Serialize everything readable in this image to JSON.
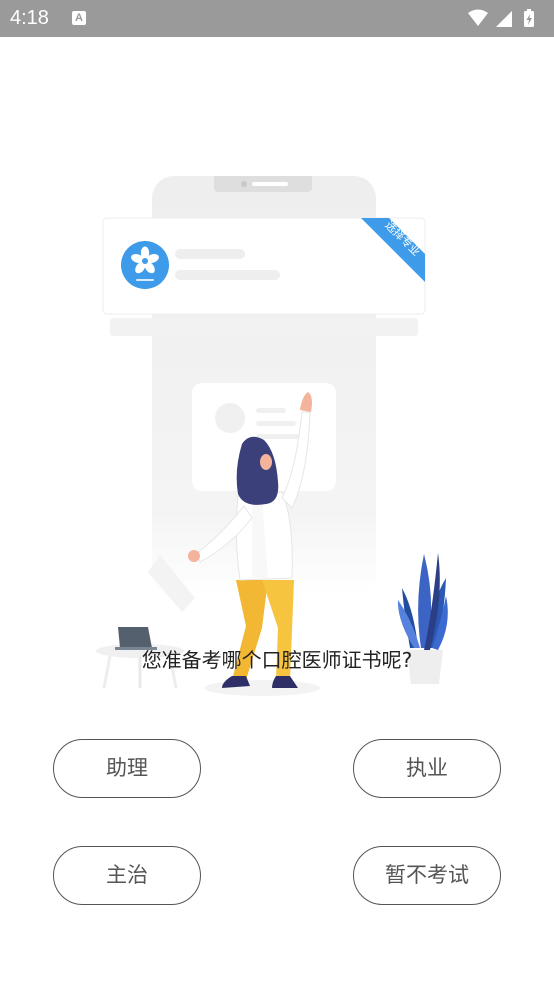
{
  "status_bar": {
    "time": "4:18",
    "notification_icon_letter": "A",
    "icons": [
      "wifi-icon",
      "signal-icon",
      "battery-charging-icon"
    ]
  },
  "illustration": {
    "ribbon_text": "选择专业",
    "accent_color": "#3d9be9"
  },
  "question": "您准备考哪个口腔医师证书呢?",
  "options": [
    {
      "label": "助理"
    },
    {
      "label": "执业"
    },
    {
      "label": "主治"
    },
    {
      "label": "暂不考试"
    }
  ]
}
